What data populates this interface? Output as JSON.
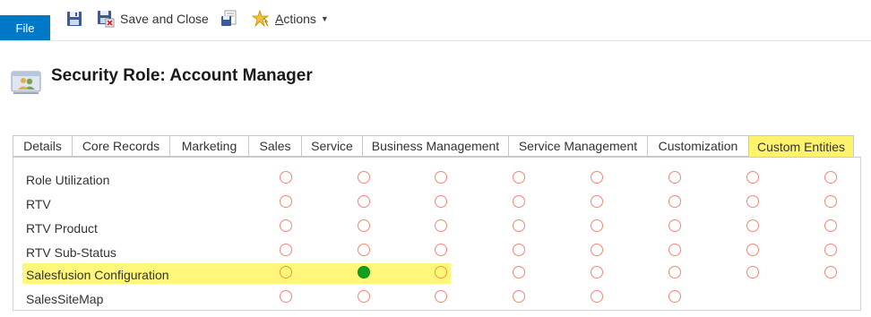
{
  "toolbar": {
    "file_label": "File",
    "save_close_label": "Save and Close",
    "actions_label": "Actions",
    "actions_mnemonic": "A",
    "actions_rest": "ctions"
  },
  "page": {
    "title": "Security Role: Account Manager"
  },
  "tabs": [
    {
      "label": "Details"
    },
    {
      "label": "Core Records"
    },
    {
      "label": "Marketing"
    },
    {
      "label": "Sales"
    },
    {
      "label": "Service"
    },
    {
      "label": "Business Management"
    },
    {
      "label": "Service Management"
    },
    {
      "label": "Customization"
    },
    {
      "label": "Custom Entities",
      "selected": true
    }
  ],
  "colors": {
    "file_tab": "#0078c8",
    "highlight": "#fff36b",
    "privilege_none": "#f08878",
    "privilege_set": "#10a020"
  },
  "rows": [
    {
      "name": "Role Utilization",
      "privileges": [
        "none",
        "none",
        "none",
        "none",
        "none",
        "none",
        "none",
        "none"
      ]
    },
    {
      "name": "RTV",
      "privileges": [
        "none",
        "none",
        "none",
        "none",
        "none",
        "none",
        "none",
        "none"
      ]
    },
    {
      "name": "RTV Product",
      "privileges": [
        "none",
        "none",
        "none",
        "none",
        "none",
        "none",
        "none",
        "none"
      ]
    },
    {
      "name": "RTV Sub-Status",
      "privileges": [
        "none",
        "none",
        "none",
        "none",
        "none",
        "none",
        "none",
        "none"
      ]
    },
    {
      "name": "Salesfusion Configuration",
      "highlighted": true,
      "privileges": [
        "none",
        "organization",
        "none",
        "none",
        "none",
        "none",
        "none",
        "none"
      ]
    },
    {
      "name": "SalesSiteMap",
      "privileges": [
        "none",
        "none",
        "none",
        "none",
        "none",
        "none"
      ]
    }
  ]
}
